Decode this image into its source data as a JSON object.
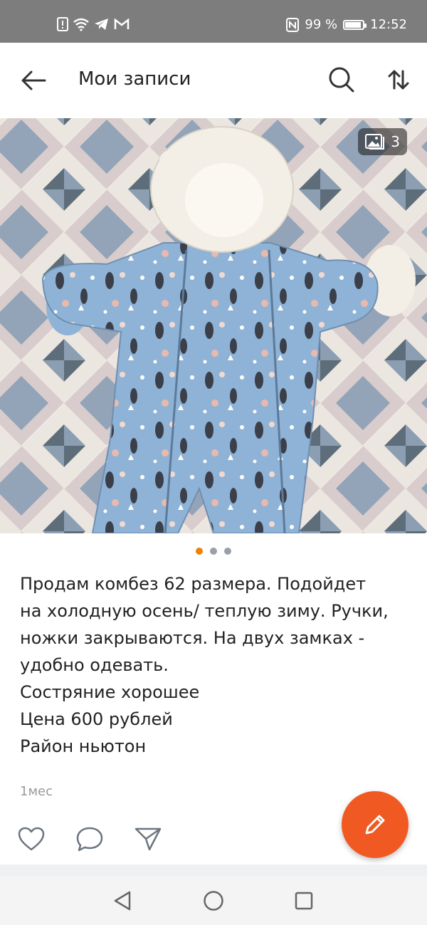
{
  "statusbar": {
    "battery_percent": "99 %",
    "battery_level": 0.99,
    "time": "12:52",
    "icons": [
      "alert-icon",
      "wifi-icon",
      "telegram-icon",
      "gmail-icon",
      "nfc-icon",
      "battery-icon"
    ]
  },
  "appbar": {
    "title": "Мои записи",
    "back_icon": "arrow-left-icon",
    "search_icon": "search-icon",
    "sort_icon": "sort-arrows-icon"
  },
  "photo": {
    "description_icon": "gallery-icon",
    "count": "3",
    "carousel_total": 3,
    "carousel_active_index": 0
  },
  "post": {
    "text": "Продам комбез 62 размера. Подойдет\nна холодную осень/ теплую зиму. Ручки,\nножки закрываются. На двух замках -\nудобно одевать.\nСостряние хорошее\nЦена 600 рублей\nРайон ньютон",
    "time": "1мес"
  },
  "actions": {
    "like_icon": "heart-icon",
    "comment_icon": "comment-icon",
    "share_icon": "send-icon",
    "edit_icon": "pencil-icon"
  },
  "colors": {
    "accent": "#ee8208",
    "fab": "#f05a22",
    "statusbar": "#7d7d7d",
    "suit": "#8fb3d6",
    "fur": "#f3efe6"
  },
  "navbar": {
    "icons": [
      "back-triangle-icon",
      "home-circle-icon",
      "recents-square-icon"
    ]
  }
}
